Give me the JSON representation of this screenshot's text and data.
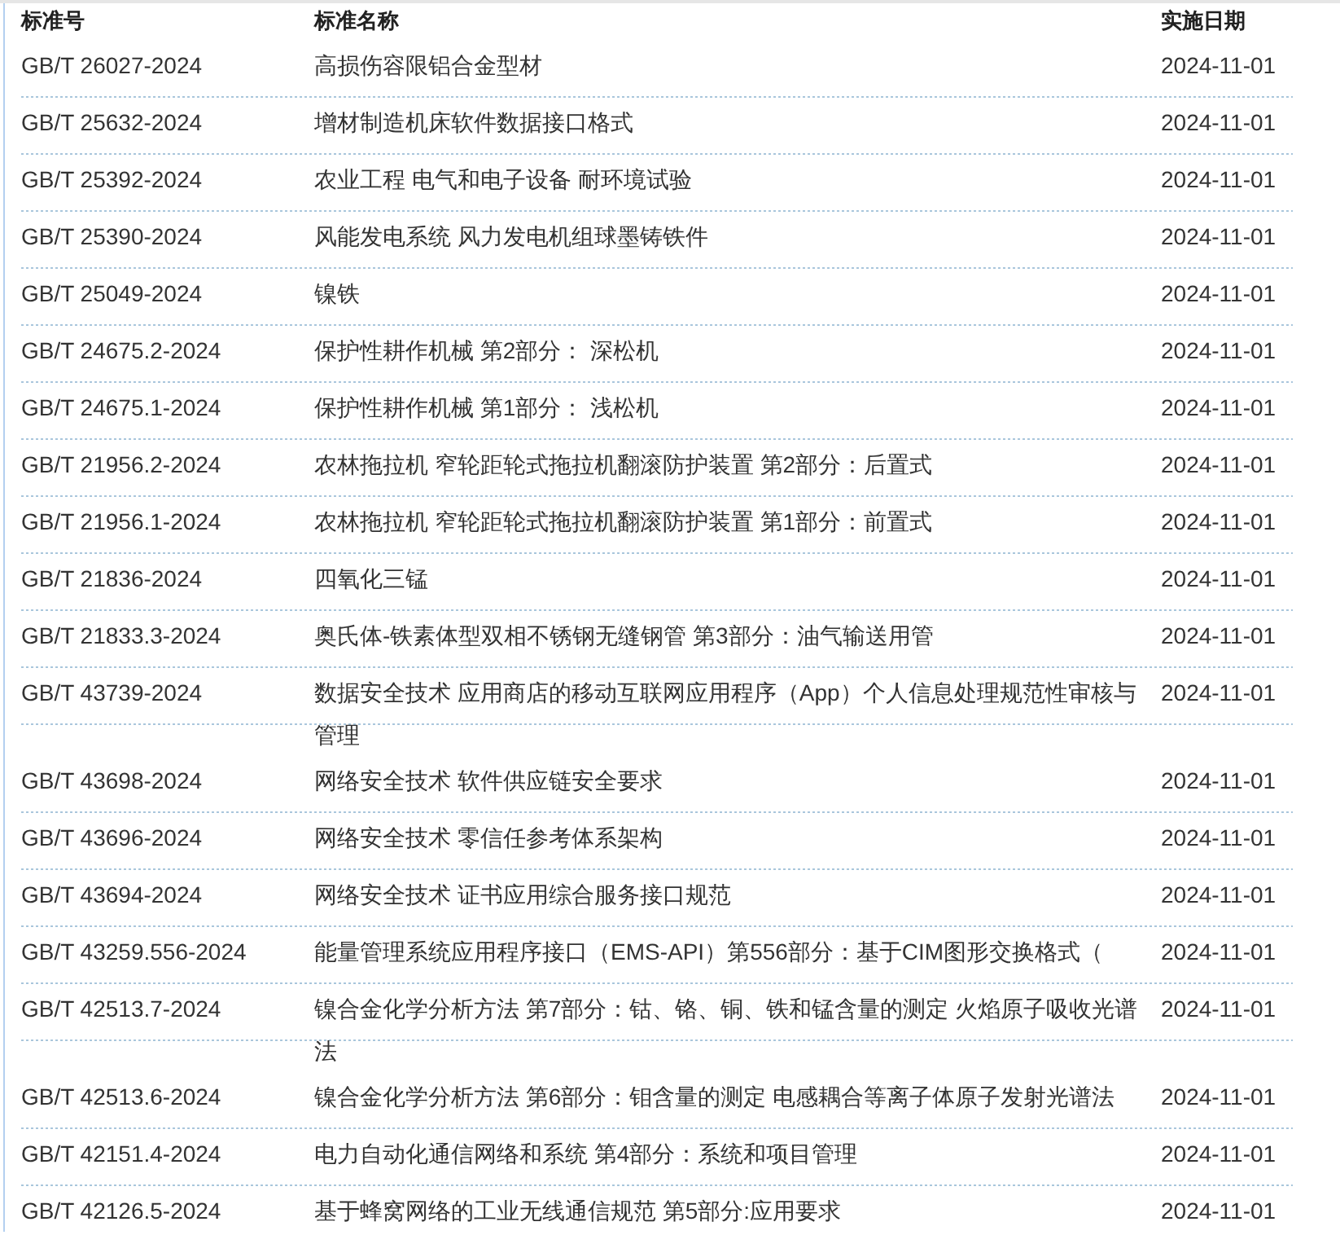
{
  "table": {
    "columns": [
      "标准号",
      "标准名称",
      "实施日期"
    ],
    "rows": [
      {
        "number": "GB/T 26027-2024",
        "name": "高损伤容限铝合金型材",
        "date": "2024-11-01"
      },
      {
        "number": "GB/T 25632-2024",
        "name": "增材制造机床软件数据接口格式",
        "date": "2024-11-01"
      },
      {
        "number": "GB/T 25392-2024",
        "name": "农业工程 电气和电子设备 耐环境试验",
        "date": "2024-11-01"
      },
      {
        "number": "GB/T 25390-2024",
        "name": "风能发电系统 风力发电机组球墨铸铁件",
        "date": "2024-11-01"
      },
      {
        "number": "GB/T 25049-2024",
        "name": "镍铁",
        "date": "2024-11-01"
      },
      {
        "number": "GB/T 24675.2-2024",
        "name": "保护性耕作机械 第2部分： 深松机",
        "date": "2024-11-01"
      },
      {
        "number": "GB/T 24675.1-2024",
        "name": "保护性耕作机械 第1部分： 浅松机",
        "date": "2024-11-01"
      },
      {
        "number": "GB/T 21956.2-2024",
        "name": "农林拖拉机 窄轮距轮式拖拉机翻滚防护装置 第2部分：后置式",
        "date": "2024-11-01"
      },
      {
        "number": "GB/T 21956.1-2024",
        "name": "农林拖拉机 窄轮距轮式拖拉机翻滚防护装置 第1部分：前置式",
        "date": "2024-11-01"
      },
      {
        "number": "GB/T 21836-2024",
        "name": "四氧化三锰",
        "date": "2024-11-01"
      },
      {
        "number": "GB/T 21833.3-2024",
        "name": "奥氏体-铁素体型双相不锈钢无缝钢管 第3部分：油气输送用管",
        "date": "2024-11-01"
      },
      {
        "number": "GB/T 43739-2024",
        "name": "数据安全技术 应用商店的移动互联网应用程序（App）个人信息处理规范性审核与管理",
        "date": "2024-11-01"
      },
      {
        "number": "GB/T 43698-2024",
        "name": "网络安全技术 软件供应链安全要求",
        "date": "2024-11-01"
      },
      {
        "number": "GB/T 43696-2024",
        "name": "网络安全技术 零信任参考体系架构",
        "date": "2024-11-01"
      },
      {
        "number": "GB/T 43694-2024",
        "name": "网络安全技术 证书应用综合服务接口规范",
        "date": "2024-11-01"
      },
      {
        "number": "GB/T 43259.556-2024",
        "name": "能量管理系统应用程序接口（EMS-API）第556部分：基于CIM图形交换格式（",
        "date": "2024-11-01"
      },
      {
        "number": "GB/T 42513.7-2024",
        "name": "镍合金化学分析方法 第7部分：钴、铬、铜、铁和锰含量的测定 火焰原子吸收光谱法",
        "date": "2024-11-01"
      },
      {
        "number": "GB/T 42513.6-2024",
        "name": "镍合金化学分析方法 第6部分：钼含量的测定 电感耦合等离子体原子发射光谱法",
        "date": "2024-11-01"
      },
      {
        "number": "GB/T 42151.4-2024",
        "name": "电力自动化通信网络和系统 第4部分：系统和项目管理",
        "date": "2024-11-01"
      },
      {
        "number": "GB/T 42126.5-2024",
        "name": "基于蜂窝网络的工业无线通信规范 第5部分:应用要求",
        "date": "2024-11-01"
      }
    ]
  }
}
